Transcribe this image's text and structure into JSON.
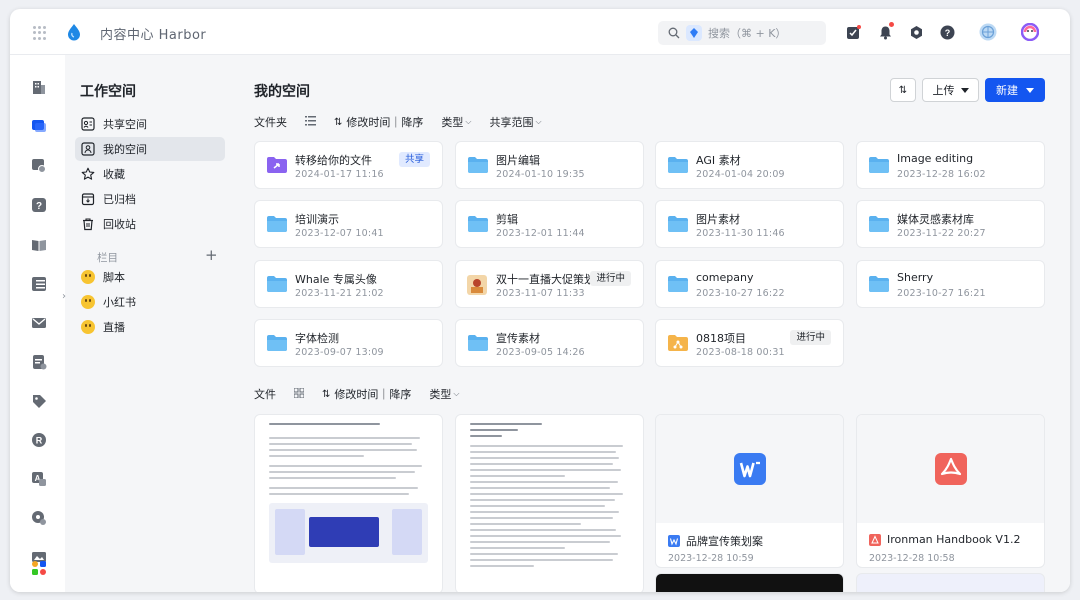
{
  "app": {
    "title": "内容中心 Harbor"
  },
  "topbar": {
    "search_placeholder": "搜索（⌘ + K）",
    "icons": [
      "grid-icon",
      "task-icon",
      "bell-icon",
      "hexagon-settings-icon",
      "help-icon",
      "avatar-globe",
      "ai-assistant-icon"
    ]
  },
  "rail": {
    "icons": [
      "building-icon",
      "chat-icon",
      "message-search-icon",
      "help-square-icon",
      "book-icon",
      "table-icon",
      "mail-icon",
      "report-icon",
      "tag-icon",
      "r-badge-icon",
      "translate-icon",
      "settings-gear-icon",
      "image-icon",
      "apps-icon"
    ]
  },
  "sidebar": {
    "title": "工作空间",
    "items": [
      {
        "label": "共享空间",
        "icon": "share-space-icon"
      },
      {
        "label": "我的空间",
        "icon": "my-space-icon",
        "active": true
      },
      {
        "label": "收藏",
        "icon": "star-icon"
      },
      {
        "label": "已归档",
        "icon": "archive-icon"
      },
      {
        "label": "回收站",
        "icon": "trash-icon"
      }
    ],
    "section_label": "栏目",
    "section_add": "+",
    "columns": [
      {
        "label": "脚本"
      },
      {
        "label": "小红书"
      },
      {
        "label": "直播"
      }
    ]
  },
  "main": {
    "title": "我的空间",
    "sort_button": "⇅",
    "upload_label": "上传",
    "new_label": "新建",
    "folder_section": {
      "label": "文件夹",
      "sort_label": "修改时间｜降序",
      "type_label": "类型",
      "scope_label": "共享范围"
    },
    "folders": [
      {
        "name": "转移给你的文件",
        "date": "2024-01-17 11:16",
        "tag": "共享",
        "tag_type": "share",
        "icon": "transfer-folder-icon"
      },
      {
        "name": "图片编辑",
        "date": "2024-01-10 19:35",
        "icon": "folder-icon"
      },
      {
        "name": "AGI 素材",
        "date": "2024-01-04 20:09",
        "icon": "folder-icon"
      },
      {
        "name": "Image editing",
        "date": "2023-12-28 16:02",
        "icon": "folder-icon"
      },
      {
        "name": "培训演示",
        "date": "2023-12-07 10:41",
        "icon": "folder-icon"
      },
      {
        "name": "剪辑",
        "date": "2023-12-01 11:44",
        "icon": "folder-icon"
      },
      {
        "name": "图片素材",
        "date": "2023-11-30 11:46",
        "icon": "folder-icon"
      },
      {
        "name": "媒体灵感素材库",
        "date": "2023-11-22 20:27",
        "icon": "folder-icon"
      },
      {
        "name": "Whale 专属头像",
        "date": "2023-11-21 21:02",
        "icon": "folder-icon"
      },
      {
        "name": "双十一直播大促策划",
        "date": "2023-11-07 11:33",
        "tag": "进行中",
        "tag_type": "progress",
        "icon": "image-thumbnail"
      },
      {
        "name": "comepany",
        "date": "2023-10-27 16:22",
        "icon": "folder-icon"
      },
      {
        "name": "Sherry",
        "date": "2023-10-27 16:21",
        "icon": "folder-icon"
      },
      {
        "name": "字体检测",
        "date": "2023-09-07 13:09",
        "icon": "folder-icon"
      },
      {
        "name": "宣传素材",
        "date": "2023-09-05 14:26",
        "icon": "folder-icon"
      },
      {
        "name": "0818项目",
        "date": "2023-08-18 00:31",
        "tag": "进行中",
        "tag_type": "progress",
        "icon": "project-folder-icon"
      }
    ],
    "file_section": {
      "label": "文件",
      "sort_label": "修改时间｜降序",
      "type_label": "类型"
    },
    "files": [
      {
        "name": "",
        "date": "",
        "kind": "doc-preview"
      },
      {
        "name": "",
        "date": "",
        "kind": "doc-preview"
      },
      {
        "name": "品牌宣传策划案",
        "date": "2023-12-28 10:59",
        "kind": "word"
      },
      {
        "name": "Ironman Handbook V1.2",
        "date": "2023-12-28 10:58",
        "kind": "pdf"
      }
    ]
  },
  "colors": {
    "accent": "#1456f0",
    "folder": "#5ab1ef",
    "word": "#3a7bf2",
    "pdf": "#f0645c"
  }
}
